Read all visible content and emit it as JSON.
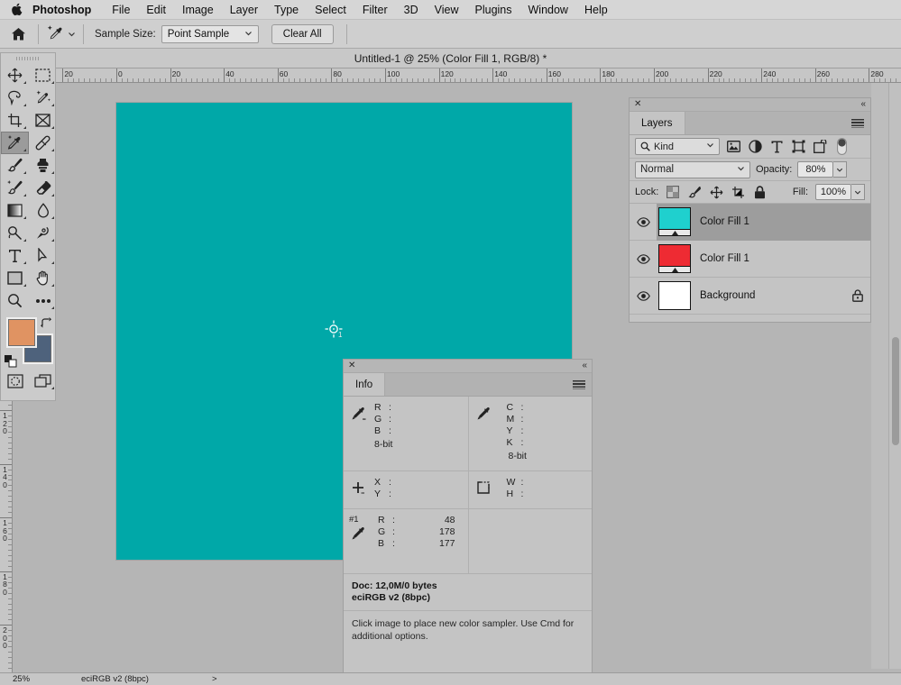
{
  "menubar": {
    "apple_icon": "apple-logo-icon",
    "app_name": "Photoshop",
    "items": [
      "File",
      "Edit",
      "Image",
      "Layer",
      "Type",
      "Select",
      "Filter",
      "3D",
      "View",
      "Plugins",
      "Window",
      "Help"
    ]
  },
  "options_bar": {
    "home_icon": "home-icon",
    "tool_icon": "eyedropper-icon",
    "sample_size_label": "Sample Size:",
    "sample_size_value": "Point Sample",
    "clear_all_label": "Clear All"
  },
  "document": {
    "tab_title": "Untitled-1 @ 25% (Color Fill 1, RGB/8) *",
    "canvas_color": "#00a8a8",
    "sampler_label": "1"
  },
  "rulers": {
    "horizontal_ticks": [
      "20",
      "0",
      "20",
      "40",
      "60",
      "80",
      "100",
      "120",
      "140",
      "160",
      "180",
      "200",
      "220",
      "240",
      "260",
      "280"
    ],
    "vertical_ticks": [
      "120",
      "140",
      "160",
      "180",
      "200"
    ]
  },
  "toolbar": {
    "tools": [
      {
        "name": "move-tool",
        "icon": "move-icon"
      },
      {
        "name": "rectangular-marquee-tool",
        "icon": "marquee-icon"
      },
      {
        "name": "lasso-tool",
        "icon": "lasso-icon"
      },
      {
        "name": "quick-selection-tool",
        "icon": "magic-wand-icon"
      },
      {
        "name": "crop-tool",
        "icon": "crop-icon"
      },
      {
        "name": "frame-tool",
        "icon": "frame-icon"
      },
      {
        "name": "eyedropper-tool",
        "icon": "eyedropper-icon",
        "active": true
      },
      {
        "name": "healing-brush-tool",
        "icon": "healing-brush-icon"
      },
      {
        "name": "brush-tool",
        "icon": "brush-icon"
      },
      {
        "name": "clone-stamp-tool",
        "icon": "stamp-icon"
      },
      {
        "name": "history-brush-tool",
        "icon": "history-brush-icon"
      },
      {
        "name": "eraser-tool",
        "icon": "eraser-icon"
      },
      {
        "name": "gradient-tool",
        "icon": "gradient-icon"
      },
      {
        "name": "blur-tool",
        "icon": "waterdrop-icon"
      },
      {
        "name": "dodge-tool",
        "icon": "dodge-icon"
      },
      {
        "name": "pen-tool",
        "icon": "pen-icon"
      },
      {
        "name": "type-tool",
        "icon": "text-t-icon"
      },
      {
        "name": "path-selection-tool",
        "icon": "arrow-cursor-icon"
      },
      {
        "name": "rectangle-tool",
        "icon": "rectangle-icon"
      },
      {
        "name": "hand-tool",
        "icon": "hand-icon"
      },
      {
        "name": "zoom-tool",
        "icon": "magnifier-icon"
      },
      {
        "name": "edit-toolbar",
        "icon": "ellipsis-icon"
      }
    ],
    "foreground_color": "#e09362",
    "background_color": "#4e627c",
    "swap_icon": "swap-colors-icon",
    "default_icon": "default-colors-icon",
    "quick_mask_icon": "quick-mask-icon",
    "screen_mode_icon": "screen-mode-icon"
  },
  "layers_panel": {
    "close_icon": "close-icon",
    "collapse_icon": "collapse-panel-icon",
    "tab_label": "Layers",
    "menu_icon": "panel-menu-icon",
    "filter": {
      "search_icon": "search-icon",
      "kind_label": "Kind",
      "caret_icon": "chevron-down-icon",
      "icons": [
        "pixel-layer-filter-icon",
        "adjustment-layer-filter-icon",
        "type-layer-filter-icon",
        "shape-layer-filter-icon",
        "smart-object-filter-icon",
        "filter-toggle-switch-icon"
      ]
    },
    "blend_mode": "Normal",
    "opacity_label": "Opacity:",
    "opacity_value": "80%",
    "lock_label": "Lock:",
    "lock_icons": [
      "lock-transparent-pixels-icon",
      "lock-image-pixels-icon",
      "lock-position-icon",
      "lock-artboard-nesting-icon",
      "lock-all-icon"
    ],
    "fill_label": "Fill:",
    "fill_value": "100%",
    "layers": [
      {
        "name": "Color Fill 1",
        "thumb_color": "#1fd0ce",
        "has_mask": true,
        "selected": true,
        "visible": true,
        "locked": false,
        "eye_icon": "eye-icon"
      },
      {
        "name": "Color Fill 1",
        "thumb_color": "#ee2b33",
        "has_mask": true,
        "selected": false,
        "visible": true,
        "locked": false,
        "eye_icon": "eye-icon"
      },
      {
        "name": "Background",
        "thumb_color": "#ffffff",
        "has_mask": false,
        "selected": false,
        "visible": true,
        "locked": true,
        "eye_icon": "eye-icon",
        "lock_icon": "lock-icon"
      }
    ]
  },
  "info_panel": {
    "close_icon": "close-icon",
    "collapse_icon": "collapse-panel-icon",
    "tab_label": "Info",
    "menu_icon": "panel-menu-icon",
    "rgb_readout": {
      "icon": "eyedropper-icon",
      "keys": [
        "R",
        "G",
        "B"
      ],
      "values": [
        "",
        "",
        ""
      ],
      "depth": "8-bit"
    },
    "cmyk_readout": {
      "icon": "eyedropper-icon",
      "keys": [
        "C",
        "M",
        "Y",
        "K"
      ],
      "values": [
        "",
        "",
        "",
        ""
      ],
      "depth": "8-bit"
    },
    "position_readout": {
      "icon": "crosshair-icon",
      "keys": [
        "X",
        "Y"
      ],
      "values": [
        "",
        ""
      ]
    },
    "dimensions_readout": {
      "icon": "selection-size-icon",
      "keys": [
        "W",
        "H"
      ],
      "values": [
        "",
        ""
      ]
    },
    "color_sampler": {
      "tag": "#1",
      "icon": "eyedropper-icon",
      "keys": [
        "R",
        "G",
        "B"
      ],
      "values": [
        "48",
        "178",
        "177"
      ]
    },
    "doc_line1": "Doc: 12,0M/0 bytes",
    "doc_line2": "eciRGB v2 (8bpc)",
    "hint": "Click image to place new color sampler.  Use Cmd for additional options."
  },
  "status_bar": {
    "zoom": "25%",
    "profile": "eciRGB v2 (8bpc)",
    "caret": ">"
  }
}
